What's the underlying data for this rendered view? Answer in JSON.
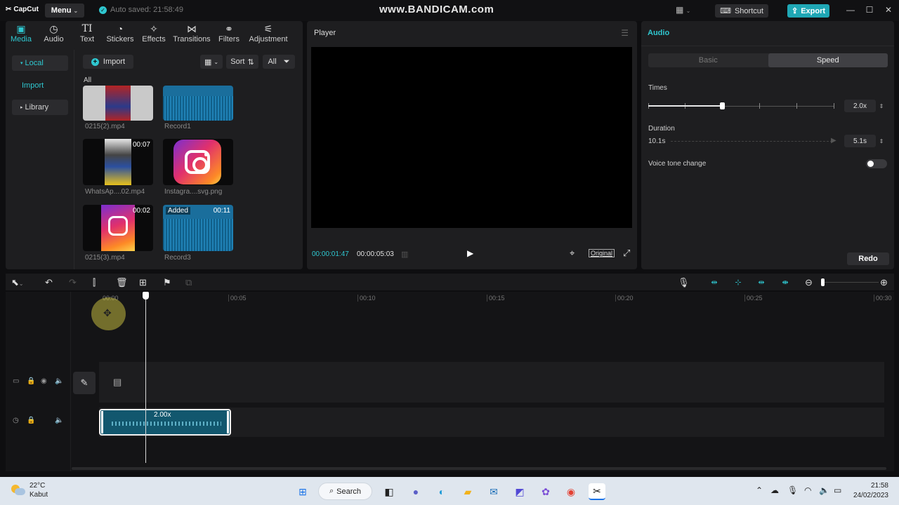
{
  "titlebar": {
    "app_name": "CapCut",
    "menu_label": "Menu",
    "autosave": "Auto saved: 21:58:49",
    "watermark": "www.BANDICAM.com",
    "shortcut_label": "Shortcut",
    "export_label": "Export"
  },
  "media": {
    "tabs": [
      {
        "label": "Media",
        "icon": "media-icon"
      },
      {
        "label": "Audio",
        "icon": "audio-icon"
      },
      {
        "label": "Text",
        "icon": "text-icon"
      },
      {
        "label": "Stickers",
        "icon": "stickers-icon"
      },
      {
        "label": "Effects",
        "icon": "effects-icon"
      },
      {
        "label": "Transitions",
        "icon": "transitions-icon"
      },
      {
        "label": "Filters",
        "icon": "filters-icon"
      },
      {
        "label": "Adjustment",
        "icon": "adjustment-icon"
      }
    ],
    "active_tab": "Media",
    "nav": {
      "local": "Local",
      "import": "Import",
      "library": "Library"
    },
    "import_label": "Import",
    "sort_label": "Sort",
    "filter_label": "All",
    "section_label": "All",
    "items": [
      {
        "name": "0215(2).mp4",
        "kind": "video",
        "duration": ""
      },
      {
        "name": "Record1",
        "kind": "audio",
        "duration": ""
      },
      {
        "name": "WhatsAp....02.mp4",
        "kind": "video",
        "duration": "00:07"
      },
      {
        "name": "Instagra....svg.png",
        "kind": "image",
        "duration": ""
      },
      {
        "name": "0215(3).mp4",
        "kind": "video",
        "duration": "00:02"
      },
      {
        "name": "Record3",
        "kind": "audio",
        "duration": "00:11",
        "badge": "Added"
      }
    ]
  },
  "player": {
    "title": "Player",
    "current_time": "00:00:01:47",
    "total_time": "00:00:05:03",
    "original_label": "Original"
  },
  "audio_panel": {
    "title": "Audio",
    "tabs": [
      "Basic",
      "Speed"
    ],
    "active_tab": "Speed",
    "times_label": "Times",
    "times_value": "2.0x",
    "times_fraction": 0.4,
    "duration_label": "Duration",
    "duration_original": "10.1s",
    "duration_value": "5.1s",
    "voice_tone_label": "Voice tone change",
    "voice_tone_on": false,
    "redo_label": "Redo"
  },
  "timeline": {
    "ruler": [
      "00:00",
      "00:05",
      "00:10",
      "00:15",
      "00:20",
      "00:25",
      "00:30"
    ],
    "clip_speed": "2.00x"
  },
  "taskbar": {
    "temperature": "22°C",
    "weather": "Kabut",
    "search_label": "Search",
    "time": "21:58",
    "date": "24/02/2023"
  },
  "colors": {
    "accent": "#2fc7d0",
    "panel": "#1e1e20",
    "background": "#0e0e10",
    "clip": "#12576e"
  }
}
